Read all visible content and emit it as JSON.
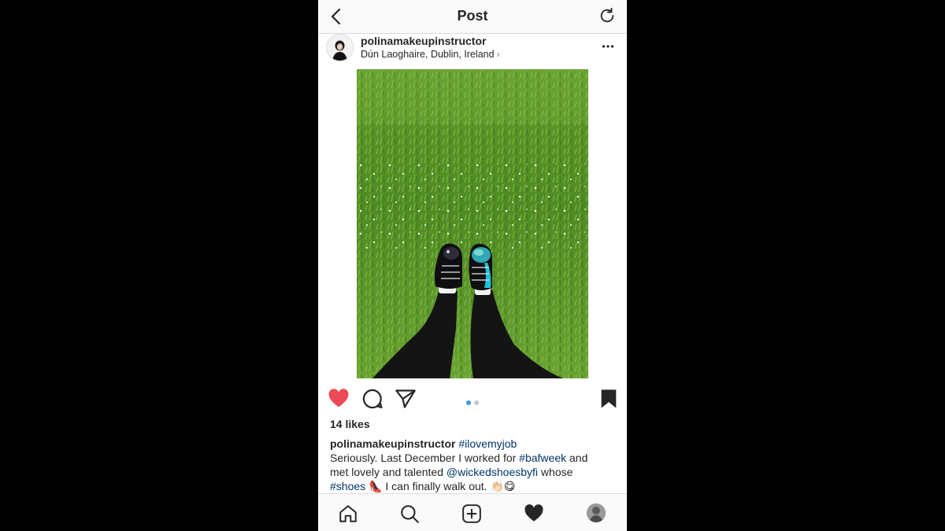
{
  "header": {
    "title": "Post"
  },
  "post": {
    "username": "polinamakeupinstructor",
    "location": "Dún Laoghaire, Dublin, Ireland",
    "location_chevron": "›",
    "likes": "14 likes",
    "liked": true,
    "carousel": {
      "count": 2,
      "active": 1
    },
    "caption": {
      "username": "polinamakeupinstructor",
      "hashtag_1": "#ilovemyjob",
      "text_1": "Seriously. Last December I worked for ",
      "hashtag_2": "#bafweek",
      "text_2": " and",
      "text_3": "met lovely and talented ",
      "mention": "@wickedshoesbyfi",
      "text_4": " whose",
      "hashtag_3": "#shoes",
      "emoji_1": "👠",
      "text_5": " I can finally walk out. ",
      "emoji_2": "👏🏻",
      "emoji_3": "😋"
    }
  },
  "icons": {
    "back": "chevron-left-icon",
    "refresh": "refresh-icon",
    "more": "more-horizontal-icon",
    "like": "heart-icon",
    "comment": "comment-icon",
    "share": "send-icon",
    "save": "bookmark-icon",
    "home": "home-icon",
    "search": "search-icon",
    "add": "add-post-icon",
    "activity": "heart-icon",
    "profile": "avatar"
  },
  "colors": {
    "like_red": "#ed4956",
    "hashtag_blue": "#003569",
    "active_dot": "#3897f0",
    "inactive_dot": "#c7c7c7",
    "border": "#dbdbdb"
  }
}
